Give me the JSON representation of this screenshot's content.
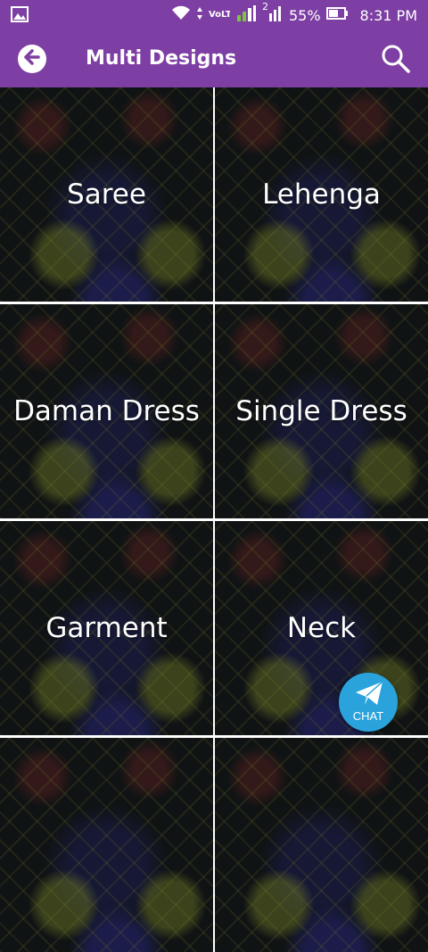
{
  "status_bar": {
    "battery_percent": "55%",
    "time": "8:31 PM",
    "volte": "VoLTE",
    "sim2": "2"
  },
  "app_bar": {
    "title": "Multi Designs",
    "back_icon": "back-arrow-icon",
    "search_icon": "search-icon"
  },
  "categories": [
    {
      "label": "Saree"
    },
    {
      "label": "Lehenga"
    },
    {
      "label": "Daman Dress"
    },
    {
      "label": "Single Dress"
    },
    {
      "label": "Garment"
    },
    {
      "label": "Neck"
    },
    {
      "label": ""
    },
    {
      "label": ""
    }
  ],
  "chat_button": {
    "label": "CHAT",
    "icon": "paper-plane-icon"
  },
  "colors": {
    "app_bar": "#7e3fa4",
    "chat_button": "#2aa3dc",
    "tile_text": "#ffffff",
    "grid_divider": "#ffffff"
  }
}
